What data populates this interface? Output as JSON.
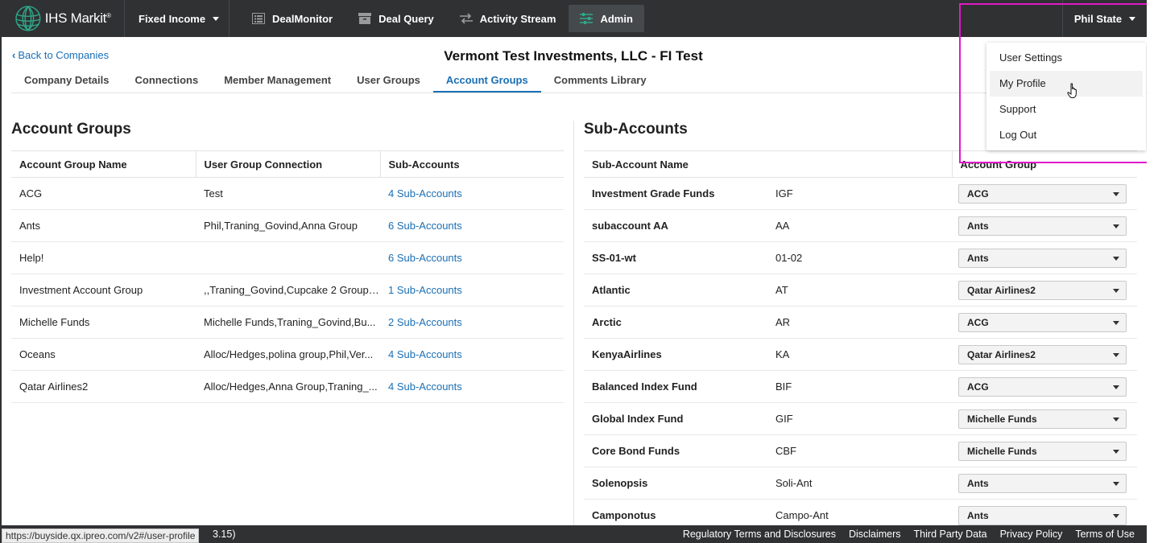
{
  "topbar": {
    "logo_text": "IHS Markit",
    "product": "Fixed Income",
    "nav": [
      {
        "label": "DealMonitor",
        "icon": "list-icon"
      },
      {
        "label": "Deal Query",
        "icon": "archive-icon"
      },
      {
        "label": "Activity Stream",
        "icon": "swap-arrows-icon"
      },
      {
        "label": "Admin",
        "icon": "sliders-icon"
      }
    ],
    "user_name": "Phil State"
  },
  "user_dropdown": {
    "items": [
      "User Settings",
      "My Profile",
      "Support",
      "Log Out"
    ]
  },
  "page": {
    "back_label": "Back to Companies",
    "title": "Vermont Test Investments, LLC - FI Test",
    "tabs": [
      "Company Details",
      "Connections",
      "Member Management",
      "User Groups",
      "Account Groups",
      "Comments Library"
    ],
    "active_tab": "Account Groups"
  },
  "account_groups": {
    "title": "Account Groups",
    "columns": [
      "Account Group Name",
      "User Group Connection",
      "Sub-Accounts"
    ],
    "rows": [
      {
        "name": "ACG",
        "connection": "Test",
        "subaccounts": "4 Sub-Accounts"
      },
      {
        "name": "Ants",
        "connection": "Phil,Traning_Govind,Anna Group",
        "subaccounts": "6 Sub-Accounts"
      },
      {
        "name": "Help!",
        "connection": "",
        "subaccounts": "6 Sub-Accounts"
      },
      {
        "name": "Investment Account Group",
        "connection": ",,Traning_Govind,Cupcake 2 Group,...",
        "subaccounts": "1 Sub-Accounts"
      },
      {
        "name": "Michelle Funds",
        "connection": "Michelle Funds,Traning_Govind,Bu...",
        "subaccounts": "2 Sub-Accounts"
      },
      {
        "name": "Oceans",
        "connection": "Alloc/Hedges,polina group,Phil,Ver...",
        "subaccounts": "4 Sub-Accounts"
      },
      {
        "name": "Qatar Airlines2",
        "connection": "Alloc/Hedges,Anna Group,Traning_...",
        "subaccounts": "4 Sub-Accounts"
      }
    ]
  },
  "sub_accounts": {
    "title": "Sub-Accounts",
    "columns": [
      "Sub-Account Name",
      "Account Group"
    ],
    "rows": [
      {
        "name": "Investment Grade Funds",
        "code": "IGF",
        "group": "ACG"
      },
      {
        "name": "subaccount AA",
        "code": "AA",
        "group": "Ants"
      },
      {
        "name": "SS-01-wt",
        "code": "01-02",
        "group": "Ants"
      },
      {
        "name": "Atlantic",
        "code": "AT",
        "group": "Qatar Airlines2"
      },
      {
        "name": "Arctic",
        "code": "AR",
        "group": "ACG"
      },
      {
        "name": "KenyaAirlines",
        "code": "KA",
        "group": "Qatar Airlines2"
      },
      {
        "name": "Balanced Index Fund",
        "code": "BIF",
        "group": "ACG"
      },
      {
        "name": "Global Index Fund",
        "code": "GIF",
        "group": "Michelle Funds"
      },
      {
        "name": "Core Bond Funds",
        "code": "CBF",
        "group": "Michelle Funds"
      },
      {
        "name": "Solenopsis",
        "code": "Soli-Ant",
        "group": "Ants"
      },
      {
        "name": "Camponotus",
        "code": "Campo-Ant",
        "group": "Ants"
      }
    ]
  },
  "footer": {
    "version_fragment": "3.15)",
    "links": [
      "Regulatory Terms and Disclosures",
      "Disclaimers",
      "Third Party Data",
      "Privacy Policy",
      "Terms of Use"
    ]
  },
  "status_bar_url": "https://buyside.qx.ipreo.com/v2#/user-profile",
  "colors": {
    "topbar": "#2f3133",
    "link": "#1a6fb5",
    "highlight": "#e019c9"
  }
}
